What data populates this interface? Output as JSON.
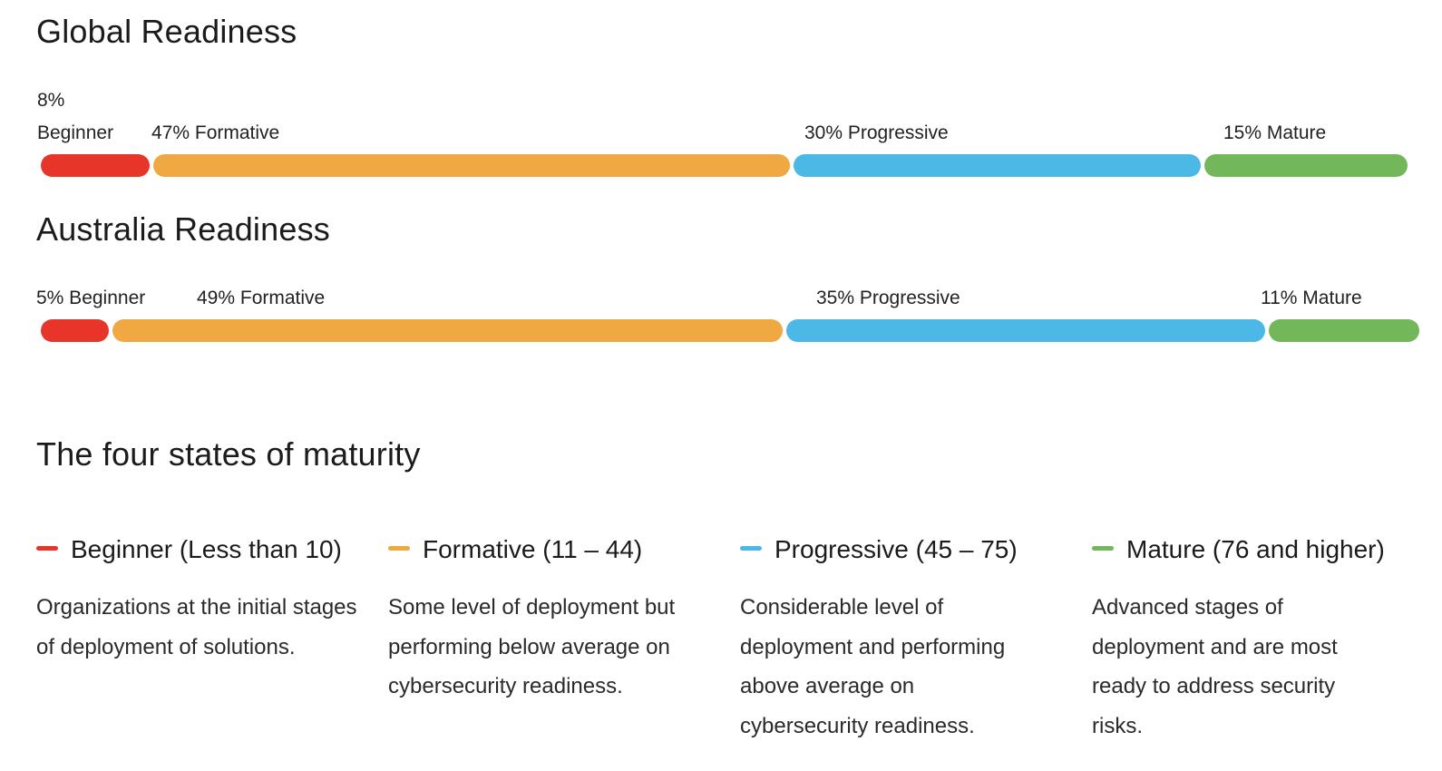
{
  "colors": {
    "beginner": "#e8352a",
    "formative": "#f0a843",
    "progressive": "#4cb8e6",
    "mature": "#72b85a"
  },
  "chart_data": [
    {
      "type": "bar",
      "orientation": "horizontal-stacked",
      "title": "Global Readiness",
      "categories": [
        "Beginner",
        "Formative",
        "Progressive",
        "Mature"
      ],
      "values": [
        8,
        47,
        30,
        15
      ],
      "unit": "%",
      "labels": [
        {
          "pct": "8%",
          "name": "Beginner"
        },
        {
          "pct": "47%",
          "name": "Formative"
        },
        {
          "pct": "30%",
          "name": "Progressive"
        },
        {
          "pct": "15%",
          "name": "Mature"
        }
      ]
    },
    {
      "type": "bar",
      "orientation": "horizontal-stacked",
      "title": "Australia Readiness",
      "categories": [
        "Beginner",
        "Formative",
        "Progressive",
        "Mature"
      ],
      "values": [
        5,
        49,
        35,
        11
      ],
      "unit": "%",
      "labels": [
        {
          "pct": "5%",
          "name": "Beginner"
        },
        {
          "pct": "49%",
          "name": "Formative"
        },
        {
          "pct": "35%",
          "name": "Progressive"
        },
        {
          "pct": "11%",
          "name": "Mature"
        }
      ]
    }
  ],
  "global": {
    "title": "Global Readiness",
    "labels": [
      "8%",
      "Beginner",
      "47% Formative",
      "30% Progressive",
      "15% Mature"
    ]
  },
  "australia": {
    "title": "Australia Readiness",
    "labels": [
      "5% Beginner",
      "49% Formative",
      "35% Progressive",
      "11% Mature"
    ]
  },
  "maturity": {
    "title": "The four states of maturity",
    "states": [
      {
        "key": "beginner",
        "label": "Beginner (Less than 10)",
        "desc": "Organizations at the initial stages of deployment of solutions."
      },
      {
        "key": "formative",
        "label": "Formative (11 – 44)",
        "desc": "Some level of deployment but performing below average on cybersecurity readiness."
      },
      {
        "key": "progressive",
        "label": "Progressive (45 – 75)",
        "desc": "Considerable level of deployment and performing above average on cybersecurity readiness."
      },
      {
        "key": "mature",
        "label": "Mature (76 and higher)",
        "desc": "Advanced stages of deployment and are most ready to address security risks."
      }
    ]
  }
}
